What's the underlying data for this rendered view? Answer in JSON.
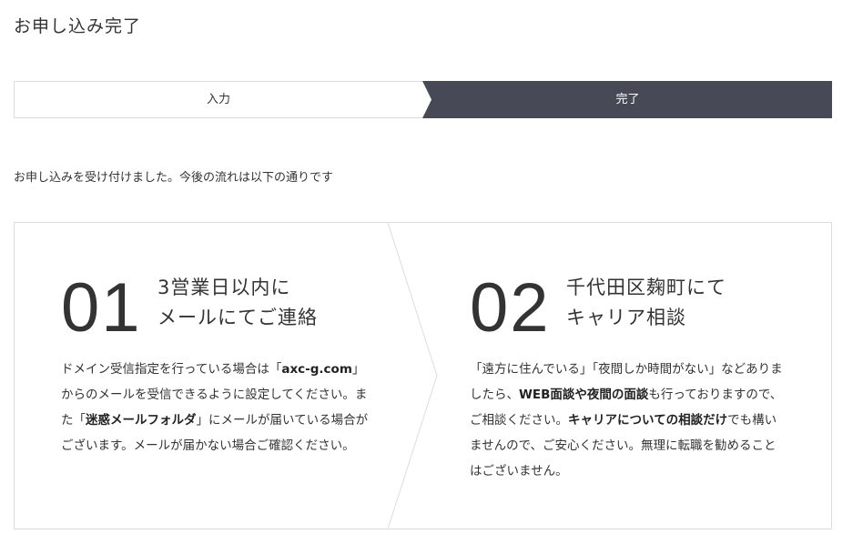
{
  "page_title": "お申し込み完了",
  "steps": [
    {
      "label": "入力",
      "state": "inactive"
    },
    {
      "label": "完了",
      "state": "active"
    }
  ],
  "lead": "お申し込みを受け付けました。今後の流れは以下の通りです",
  "colors": {
    "active_step_bg": "#474a56",
    "border": "#dddddd",
    "text": "#333333"
  },
  "flow": [
    {
      "number": "01",
      "heading_line1": "3営業日以内に",
      "heading_line2": "メールにてご連絡",
      "desc": [
        {
          "text": "ドメイン受信指定を行っている場合は「",
          "bold": false
        },
        {
          "text": "axc-g.com",
          "bold": true
        },
        {
          "text": "」からのメールを受信できるように設定してください。また「",
          "bold": false
        },
        {
          "text": "迷惑メールフォルダ",
          "bold": true
        },
        {
          "text": "」にメールが届いている場合がございます。メールが届かない場合ご確認ください。",
          "bold": false
        }
      ]
    },
    {
      "number": "02",
      "heading_line1": "千代田区麹町にて",
      "heading_line2": "キャリア相談",
      "desc": [
        {
          "text": "「遠方に住んでいる」「夜間しか時間がない」などありましたら、",
          "bold": false
        },
        {
          "text": "WEB面談や夜間の面談",
          "bold": true
        },
        {
          "text": "も行っておりますので、ご相談ください。",
          "bold": false
        },
        {
          "text": "キャリアについての相談だけ",
          "bold": true
        },
        {
          "text": "でも構いませんので、ご安心ください。無理に転職を勧めることはございません。",
          "bold": false
        }
      ]
    }
  ]
}
